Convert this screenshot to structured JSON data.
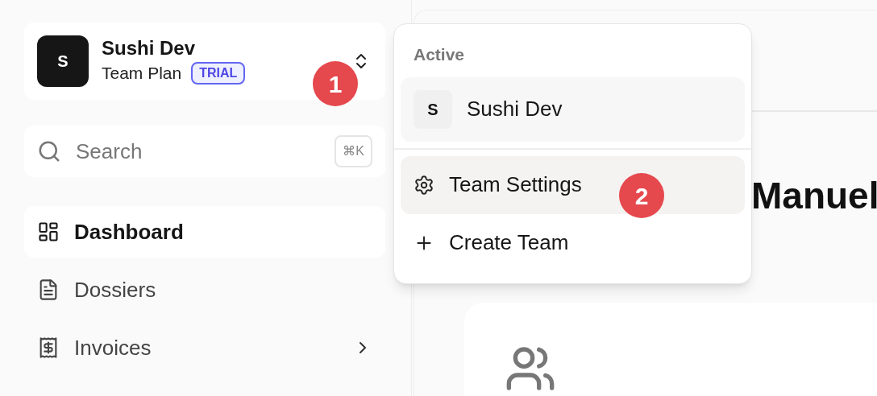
{
  "team_switcher": {
    "avatar": "S",
    "name": "Sushi Dev",
    "plan": "Team Plan",
    "badge": "TRIAL"
  },
  "search": {
    "placeholder": "Search",
    "shortcut": "⌘K"
  },
  "sidebar": {
    "items": [
      {
        "label": "Dashboard",
        "kind": "link",
        "selected": true
      },
      {
        "label": "Dossiers",
        "kind": "link",
        "selected": false
      },
      {
        "label": "Invoices",
        "kind": "group",
        "selected": false
      }
    ]
  },
  "main": {
    "heading": "Manuel"
  },
  "dropdown": {
    "section": "Active",
    "active_team": {
      "avatar": "S",
      "name": "Sushi Dev"
    },
    "items": [
      {
        "label": "Team Settings",
        "highlighted": true
      },
      {
        "label": "Create Team",
        "highlighted": false
      }
    ]
  },
  "callouts": [
    "1",
    "2"
  ]
}
